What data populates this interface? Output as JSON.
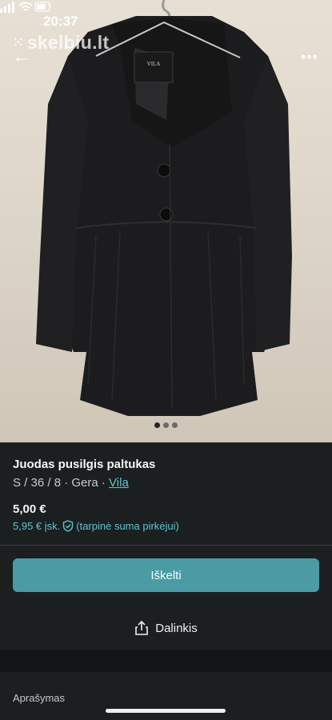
{
  "status_bar": {
    "time": "20:37"
  },
  "watermark": "skelbiu.lt",
  "nav": {
    "back_icon": "arrow-left-icon",
    "more_label": "•••"
  },
  "gallery": {
    "image_count": 3,
    "active_index": 0
  },
  "item": {
    "title": "Juodas pusilgis paltukas",
    "meta_prefix": "S / 36 / 8 · Gera · ",
    "brand": "Vila",
    "price": "5,00 €",
    "fee_text": "5,95 € įsk.",
    "fee_note": "(tarpinė suma pirkėjui)"
  },
  "actions": {
    "primary_label": "Iškelti",
    "share_label": "Dalinkis"
  },
  "description": {
    "label": "Aprašymas"
  },
  "colors": {
    "accent": "#4a9ba4",
    "link": "#5fc4cf",
    "background": "#1b1f20"
  }
}
